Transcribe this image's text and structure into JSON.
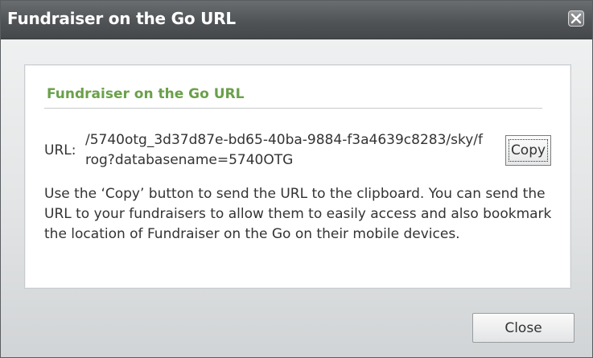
{
  "dialog": {
    "title": "Fundraiser on the Go URL",
    "close_icon": "close-x-icon"
  },
  "panel": {
    "section_title": "Fundraiser on the Go URL",
    "url_label": "URL:",
    "url_value": "/5740otg_3d37d87e-bd65-40ba-9884-f3a4639c8283/sky/frog?databasename=5740OTG",
    "copy_label": "Copy",
    "description": "Use the ‘Copy’ button to send the URL to the clipboard. You can send the URL to your fundraisers to allow them to easily access and also bookmark the location of Fundraiser on the Go on their mobile devices."
  },
  "footer": {
    "close_label": "Close"
  },
  "colors": {
    "titlebar": "#4f5255",
    "section_title": "#6aa04a",
    "text": "#333333"
  }
}
